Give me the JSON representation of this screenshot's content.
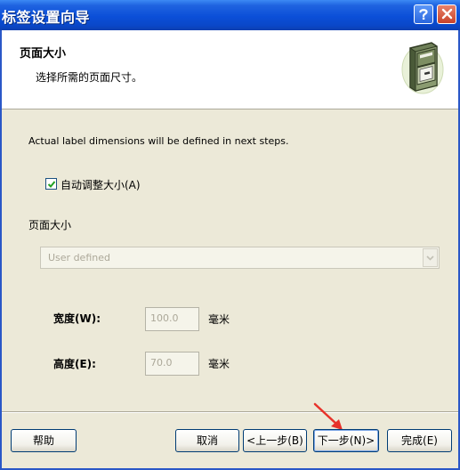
{
  "window": {
    "title": "标签设置向导"
  },
  "titlebar_buttons": {
    "help_icon": "question-mark-icon",
    "close_icon": "close-x-icon"
  },
  "header": {
    "title": "页面大小",
    "subtitle": "选择所需的页面尺寸。",
    "icon": "file-cabinet-icon"
  },
  "body": {
    "info_text": "Actual label dimensions will be defined in next steps.",
    "auto_resize": {
      "label": "自动调整大小(A)",
      "checked": true
    },
    "page_size_label": "页面大小",
    "page_size_select": {
      "value": "User defined",
      "disabled": true
    },
    "width": {
      "label": "宽度(W):",
      "value": "100.0",
      "unit": "毫米"
    },
    "height": {
      "label": "高度(E):",
      "value": "70.0",
      "unit": "毫米"
    }
  },
  "footer": {
    "help_label": "帮助",
    "cancel_label": "取消",
    "back_label": "<上一步(B)",
    "next_label": "下一步(N)>",
    "finish_label": "完成(E)"
  },
  "colors": {
    "titlebar": "#0b4fd8",
    "dialog_bg": "#ece9d8",
    "annotation_arrow": "#e8322a"
  }
}
